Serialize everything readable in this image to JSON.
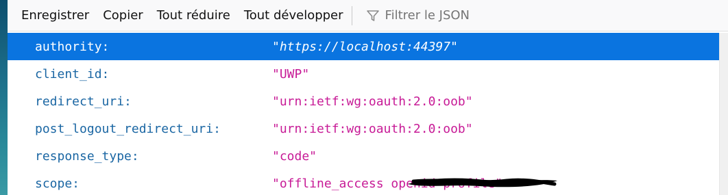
{
  "toolbar": {
    "save_label": "Enregistrer",
    "copy_label": "Copier",
    "collapse_all_label": "Tout réduire",
    "expand_all_label": "Tout développer",
    "filter_placeholder": "Filtrer le JSON",
    "filter_value": ""
  },
  "json_rows": [
    {
      "key": "authority:",
      "value": "\"https://localhost:44397\"",
      "selected": true
    },
    {
      "key": "client_id:",
      "value": "\"UWP\"",
      "selected": false
    },
    {
      "key": "redirect_uri:",
      "value": "\"urn:ietf:wg:oauth:2.0:oob\"",
      "selected": false
    },
    {
      "key": "post_logout_redirect_uri:",
      "value": "\"urn:ietf:wg:oauth:2.0:oob\"",
      "selected": false
    },
    {
      "key": "response_type:",
      "value": "\"code\"",
      "selected": false
    },
    {
      "key": "scope:",
      "value": "\"offline_access                 openid profile\"",
      "selected": false
    }
  ],
  "colors": {
    "key": "#1a66a3",
    "string_value": "#c71a96",
    "selection": "#0a74e0",
    "toolbar_bg": "#f9f9fa"
  },
  "icons": {
    "filter": "funnel-filter-icon",
    "redaction": "black-scribble-redaction"
  }
}
